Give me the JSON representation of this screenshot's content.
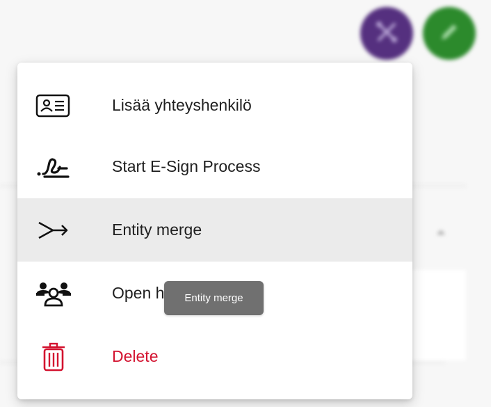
{
  "colors": {
    "accent_purple": "#55307f",
    "accent_green": "#2c8a2c",
    "danger": "#d3122f",
    "hover_bg": "#ebebeb",
    "tooltip_bg": "#707070"
  },
  "fabs": [
    {
      "icon": "tools-icon"
    },
    {
      "icon": "pencil-icon"
    }
  ],
  "menu": {
    "items": [
      {
        "label": "Lisää yhteyshenkilö",
        "icon": "contact-card-icon"
      },
      {
        "label": "Start E-Sign Process",
        "icon": "signature-icon"
      },
      {
        "label": "Entity merge",
        "icon": "merge-arrow-icon",
        "state": "hovered"
      },
      {
        "label": "Open h",
        "icon": "team-icon"
      },
      {
        "label": "Delete",
        "icon": "trash-icon",
        "style": "danger"
      }
    ]
  },
  "tooltip": {
    "text": "Entity merge"
  }
}
